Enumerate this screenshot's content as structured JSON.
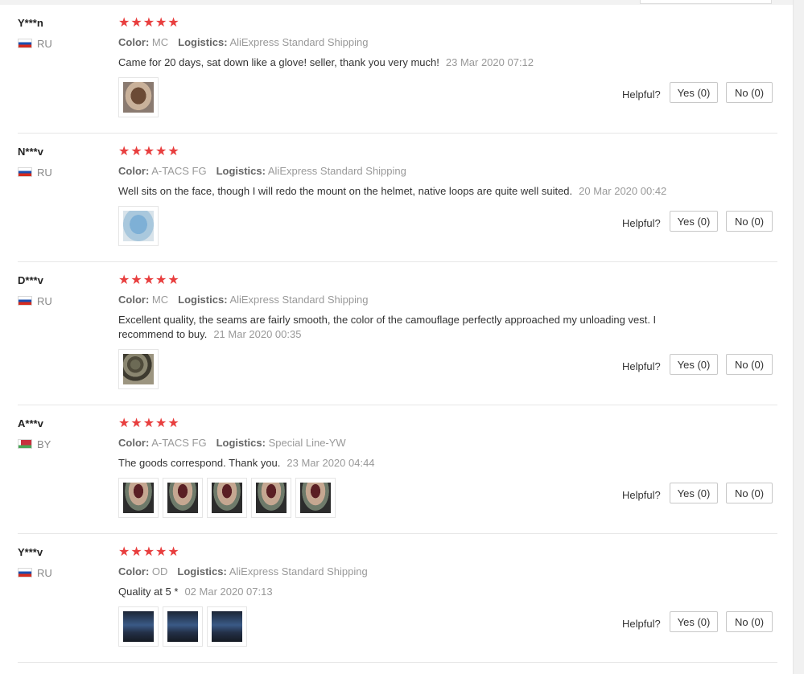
{
  "helpful_label": "Helpful?",
  "labels": {
    "color": "Color:",
    "logistics": "Logistics:"
  },
  "reviews": [
    {
      "user": "Y***n",
      "country": "RU",
      "rating": "★★★★★",
      "color": "MC",
      "logistics": "AliExpress Standard Shipping",
      "text": "Came for 20 days, sat down like a glove! seller, thank you very much!",
      "date": "23 Mar 2020 07:12",
      "photos": [
        "mask-photo"
      ],
      "yes_label": "Yes (0)",
      "no_label": "No (0)"
    },
    {
      "user": "N***v",
      "country": "RU",
      "rating": "★★★★★",
      "color": "A-TACS FG",
      "logistics": "AliExpress Standard Shipping",
      "text": "Well sits on the face, though I will redo the mount on the helmet, native loops are quite well suited.",
      "date": "20 Mar 2020 00:42",
      "photos": [
        "blue-mask-photo"
      ],
      "yes_label": "Yes (0)",
      "no_label": "No (0)"
    },
    {
      "user": "D***v",
      "country": "RU",
      "rating": "★★★★★",
      "color": "MC",
      "logistics": "AliExpress Standard Shipping",
      "text": "Excellent quality, the seams are fairly smooth, the color of the camouflage perfectly approached my unloading vest. I recommend to buy.",
      "date": "21 Mar 2020 00:35",
      "photos": [
        "camo-vest-photo"
      ],
      "yes_label": "Yes (0)",
      "no_label": "No (0)"
    },
    {
      "user": "A***v",
      "country": "BY",
      "rating": "★★★★★",
      "color": "A-TACS FG",
      "logistics": "Special Line-YW",
      "text": "The goods correspond. Thank you.",
      "date": "23 Mar 2020 04:44",
      "photos": [
        "face-photo",
        "face-photo",
        "face-photo",
        "face-photo",
        "face-photo"
      ],
      "yes_label": "Yes (0)",
      "no_label": "No (0)"
    },
    {
      "user": "Y***v",
      "country": "RU",
      "rating": "★★★★★",
      "color": "OD",
      "logistics": "AliExpress Standard Shipping",
      "text": "Quality at 5 *",
      "date": "02 Mar 2020 07:13",
      "photos": [
        "dark-photo",
        "dark-photo",
        "dark-photo"
      ],
      "yes_label": "Yes (0)",
      "no_label": "No (0)"
    }
  ]
}
